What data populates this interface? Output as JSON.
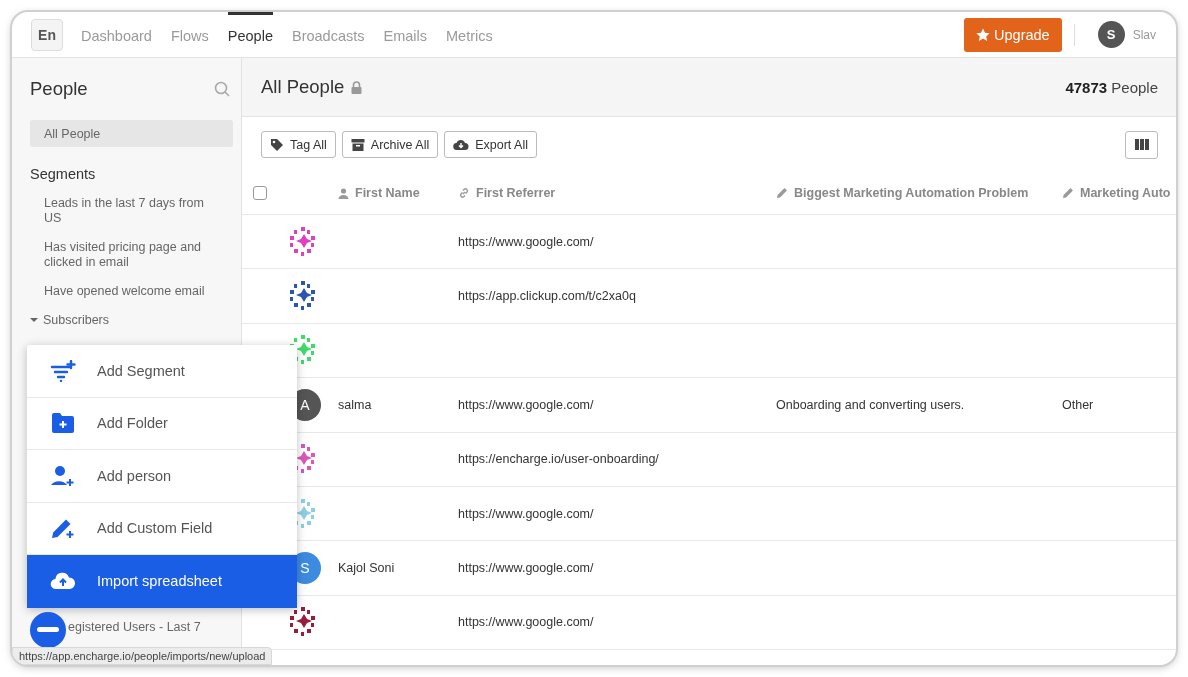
{
  "nav": {
    "logo": "En",
    "tabs": [
      {
        "label": "Dashboard",
        "selected": false
      },
      {
        "label": "Flows",
        "selected": false
      },
      {
        "label": "People",
        "selected": true
      },
      {
        "label": "Broadcasts",
        "selected": false
      },
      {
        "label": "Emails",
        "selected": false
      },
      {
        "label": "Metrics",
        "selected": false
      }
    ],
    "upgrade": "Upgrade",
    "user": {
      "initial": "S",
      "name": "Slav"
    }
  },
  "sidebar": {
    "title": "People",
    "items": [
      {
        "label": "All People",
        "selected": true
      }
    ],
    "section": "Segments",
    "segments": [
      {
        "label": "Leads in the last 7 days from US"
      },
      {
        "label": "Has visited pricing page and clicked in email"
      },
      {
        "label": "Have opened welcome email"
      }
    ],
    "folders": [
      {
        "label": "Subscribers",
        "expanded": true,
        "children": [
          {
            "label": "egistered Users - Last 7"
          }
        ]
      }
    ]
  },
  "main": {
    "title": "All People",
    "locked": true,
    "count": "**47873** People",
    "actions": [
      {
        "kind": "tag",
        "label": "Tag All"
      },
      {
        "kind": "archive",
        "label": "Archive All"
      },
      {
        "kind": "export",
        "label": "Export All"
      }
    ]
  },
  "table": {
    "select_all": {
      "checked": false
    },
    "columns": [
      {
        "kind": "person",
        "label": "First Name"
      },
      {
        "kind": "link",
        "label": "First Referrer"
      },
      {
        "kind": "pencil",
        "label": "Biggest Marketing Automation Problem"
      },
      {
        "kind": "pencil",
        "label": "Marketing Auto"
      }
    ],
    "rows": [
      {
        "avatar": {
          "kind": "identicon",
          "color": "#e040c0"
        },
        "cells": [
          "",
          "https://www.google.com/",
          "",
          ""
        ]
      },
      {
        "avatar": {
          "kind": "identicon",
          "color": "#2a55b0"
        },
        "cells": [
          "",
          "https://app.clickup.com/t/c2xa0q",
          "",
          ""
        ]
      },
      {
        "avatar": {
          "kind": "identicon",
          "color": "#3ddc6a"
        },
        "cells": [
          "",
          "",
          "",
          ""
        ]
      },
      {
        "avatar": {
          "kind": "letter",
          "color": "#555555",
          "letter": "A"
        },
        "cells": [
          "salma",
          "https://www.google.com/",
          "Onboarding and converting users.",
          "Other"
        ]
      },
      {
        "avatar": {
          "kind": "identicon",
          "color": "#d858b8"
        },
        "cells": [
          "",
          "https://encharge.io/user-onboarding/",
          "",
          ""
        ]
      },
      {
        "avatar": {
          "kind": "identicon",
          "color": "#8ccfe0"
        },
        "cells": [
          "",
          "https://www.google.com/",
          "",
          ""
        ]
      },
      {
        "avatar": {
          "kind": "letter",
          "color": "#3d8be0",
          "letter": "S"
        },
        "cells": [
          "Kajol Soni",
          "https://www.google.com/",
          "",
          ""
        ]
      },
      {
        "avatar": {
          "kind": "identicon",
          "color": "#9a1c3a"
        },
        "cells": [
          "",
          "https://www.google.com/",
          "",
          ""
        ]
      }
    ]
  },
  "menu": [
    {
      "kind": "segment",
      "label": "Add Segment",
      "selected": false
    },
    {
      "kind": "folder",
      "label": "Add Folder",
      "selected": false
    },
    {
      "kind": "person",
      "label": "Add person",
      "selected": false
    },
    {
      "kind": "field",
      "label": "Add Custom Field",
      "selected": false
    },
    {
      "kind": "upload",
      "label": "Import spreadsheet",
      "selected": true
    }
  ],
  "status_url": "https://app.encharge.io/people/imports/new/upload"
}
